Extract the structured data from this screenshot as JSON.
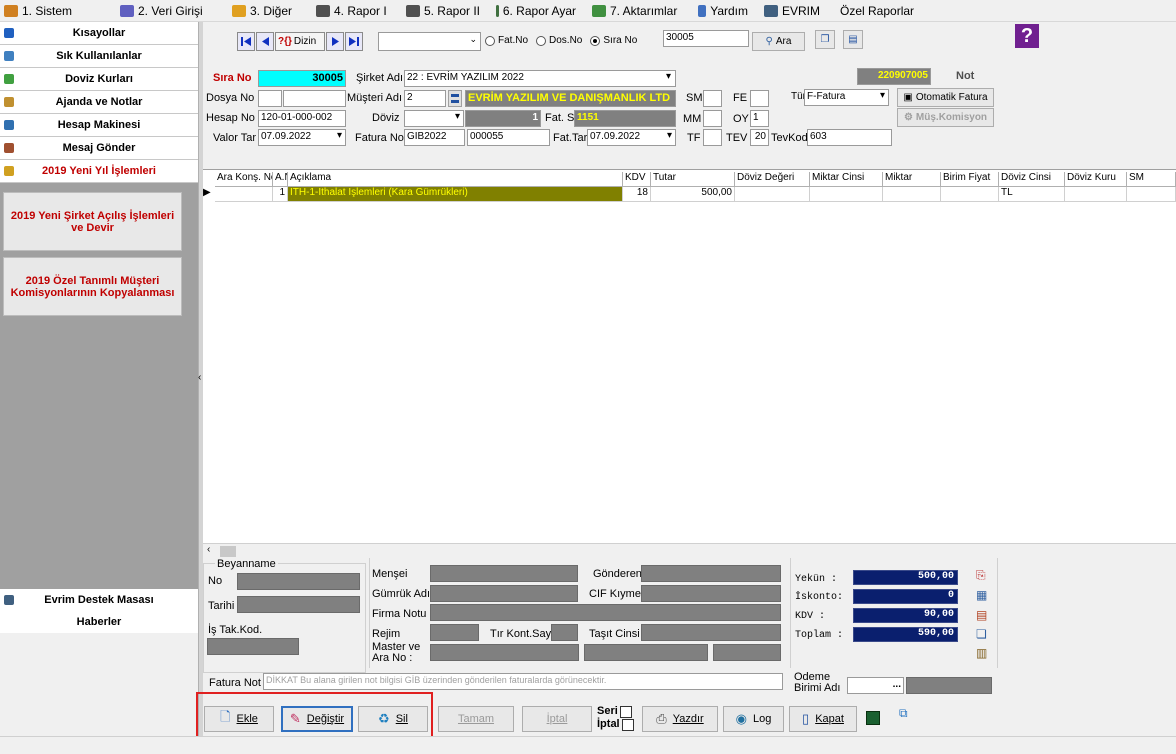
{
  "menu": [
    {
      "label": "1. Sistem",
      "icon": "system-icon",
      "color": "#d08020"
    },
    {
      "label": "2. Veri Girişi",
      "icon": "data-entry-icon",
      "color": "#6060c0"
    },
    {
      "label": "3. Diğer",
      "icon": "other-icon",
      "color": "#e0a020"
    },
    {
      "label": "4. Rapor I",
      "icon": "printer-icon",
      "color": "#505050"
    },
    {
      "label": "5. Rapor II",
      "icon": "printer-icon",
      "color": "#505050"
    },
    {
      "label": "6. Rapor Ayar",
      "icon": "report-settings-icon",
      "color": "#407040"
    },
    {
      "label": "7. Aktarımlar",
      "icon": "transfer-icon",
      "color": "#409040"
    },
    {
      "label": "Yardım",
      "icon": "help-icon",
      "color": "#4070c0"
    },
    {
      "label": "EVRIM",
      "icon": "evrim-icon",
      "color": "#406080"
    },
    {
      "label": "Özel Raporlar",
      "icon": "",
      "color": ""
    }
  ],
  "sidebar": {
    "items": [
      {
        "label": "Kısayollar",
        "icon": "shortcuts-icon",
        "color": "#2060c0",
        "red": false
      },
      {
        "label": "Sık Kullanılanlar",
        "icon": "favorites-icon",
        "color": "#4080c0",
        "red": false
      },
      {
        "label": "Doviz Kurları",
        "icon": "currency-icon",
        "color": "#40a040",
        "red": false
      },
      {
        "label": "Ajanda ve Notlar",
        "icon": "agenda-icon",
        "color": "#c09030",
        "red": false
      },
      {
        "label": "Hesap Makinesi",
        "icon": "calculator-icon",
        "color": "#3070b0",
        "red": false
      },
      {
        "label": "Mesaj Gönder",
        "icon": "message-icon",
        "color": "#a05030",
        "red": false
      },
      {
        "label": "2019 Yeni Yıl İşlemleri",
        "icon": "new-year-icon",
        "color": "#d0a020",
        "red": true
      }
    ],
    "big_buttons": [
      "2019 Yeni Şirket Açılış İşlemleri ve Devir",
      "2019 Özel Tanımlı Müşteri Komisyonlarının Kopyalanması"
    ],
    "bottom_items": [
      {
        "label": "Evrim Destek Masası",
        "icon": "support-icon",
        "color": "#406080"
      },
      {
        "label": "Haberler",
        "icon": "",
        "color": ""
      }
    ]
  },
  "nav": {
    "dizin_label": "Dizin",
    "search_options": [
      "Fat.No",
      "Dos.No",
      "Sıra No"
    ],
    "selected_option": "Sıra No",
    "search_value": "30005",
    "search_button": "Ara",
    "help_symbol": "?"
  },
  "form": {
    "sira_no_label": "Sıra No",
    "sira_no": "30005",
    "sirket_adi_label": "Şirket Adı",
    "sirket_adi": "22 : EVRİM YAZILIM  2022",
    "doc_number": "220907005",
    "not_label": "Not",
    "dosya_no_label": "Dosya No",
    "musteri_adi_label": "Müşteri Adı",
    "musteri_code": "2",
    "musteri_name": "EVRİM YAZILIM VE DANIŞMANLIK LTD",
    "sm_label": "SM",
    "fe_label": "FE",
    "tur_label": "Tür",
    "tur_value": "F-Fatura",
    "otomatik_fatura": "Otomatik Fatura",
    "mus_komisyon": "Müş.Komisyon",
    "hesap_no_label": "Hesap No",
    "hesap_no": "120-01-000-002",
    "doviz_label": "Döviz",
    "doviz_amount": "1",
    "fat_say_label": "Fat. Say",
    "fat_say": "1151",
    "mm_label": "MM",
    "oy_label": "OY",
    "oy_value": "1",
    "valor_tar_label": "Valor Tar",
    "valor_tar": "07.09.2022",
    "fatura_no_label": "Fatura No",
    "fatura_seri": "GIB2022",
    "fatura_no": "000055",
    "fat_tar_label": "Fat.Tar",
    "fat_tar": "07.09.2022",
    "tf_label": "TF",
    "tev_label": "TEV",
    "tev_value": "20",
    "tevkod_label": "TevKod",
    "tevkod_value": "603"
  },
  "grid": {
    "columns": [
      "Ara Konş. No",
      "A.No",
      "Açıklama",
      "KDV",
      "Tutar",
      "Döviz Değeri",
      "Miktar Cinsi",
      "Miktar",
      "Birim Fiyat",
      "Döviz Cinsi",
      "Döviz Kuru",
      "SM"
    ],
    "rows": [
      {
        "ara_kons": "",
        "a_no": "1",
        "aciklama": "İTH-1-İthalat İşlemleri (Kara Gümrükleri)",
        "kdv": "18",
        "tutar": "500,00",
        "doviz_degeri": "",
        "miktar_cinsi": "",
        "miktar": "",
        "birim_fiyat": "",
        "doviz_cinsi": "TL",
        "doviz_kuru": "",
        "sm": ""
      }
    ]
  },
  "beyanname": {
    "title": "Beyanname",
    "no_label": "No",
    "tarihi_label": "Tarihi",
    "is_tak_kod_label": "İş Tak.Kod.",
    "mensei_label": "Menşei",
    "gonderen_label": "Gönderen",
    "gumruk_adi_label": "Gümrük Adı",
    "cif_kiymet_label": "CIF Kıymet",
    "firma_notu_label": "Firma Notu",
    "rejim_label": "Rejim",
    "tir_kont_say_label": "Tır Kont.Say",
    "tasit_cinsi_label": "Taşıt Cinsi",
    "master_label": "Master ve Ara No :"
  },
  "totals": {
    "yekun_label": "Yekün  :",
    "yekun": "500,00",
    "iskonto_label": "İskonto:",
    "iskonto": "0",
    "kdv_label": "KDV    :",
    "kdv": "90,00",
    "toplam_label": "Toplam :",
    "toplam": "590,00"
  },
  "fatura_not": {
    "label": "Fatura Not",
    "placeholder": "DİKKAT Bu alana girilen not bilgisi GİB üzerinden gönderilen faturalarda görünecektir."
  },
  "odeme_label": "Ödeme Birimi Adı",
  "odeme_button": "...",
  "actions": {
    "ekle": "Ekle",
    "degistir": "Değiştir",
    "sil": "Sil",
    "tamam": "Tamam",
    "iptal": "İptal",
    "seri_label": "Seri",
    "iptal_check_label": "İptal",
    "yazdir": "Yazdır",
    "log": "Log",
    "kapat": "Kapat"
  }
}
